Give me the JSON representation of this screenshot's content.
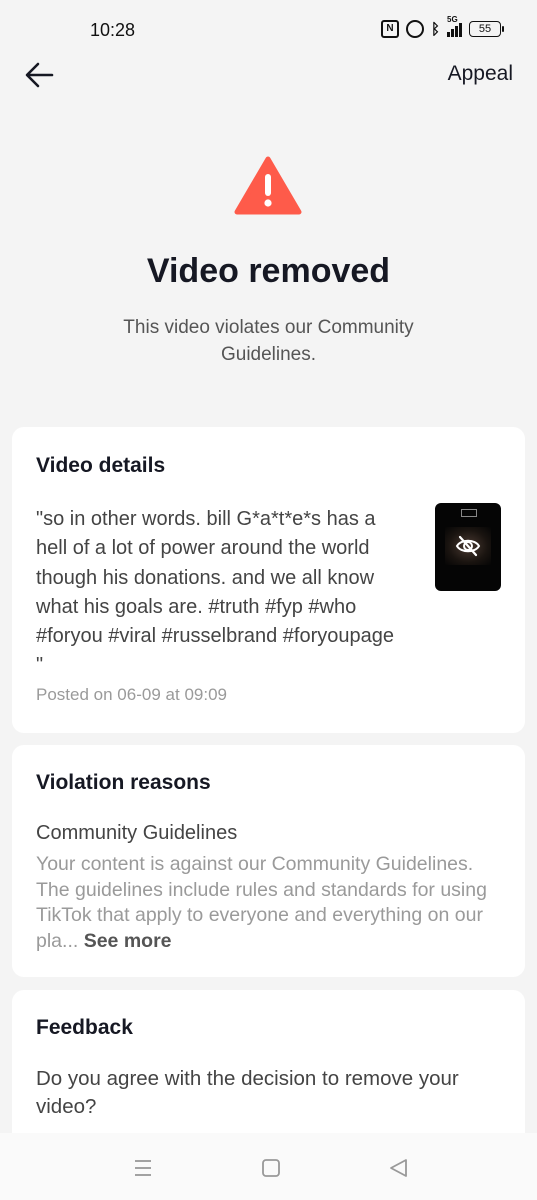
{
  "status_bar": {
    "time": "10:28",
    "network": "5G",
    "battery": "55",
    "icons": [
      "nfc-icon",
      "alarm-icon",
      "bluetooth-icon",
      "signal-icon",
      "battery-icon"
    ]
  },
  "header": {
    "back_icon": "back-arrow-icon",
    "appeal_label": "Appeal"
  },
  "hero": {
    "icon": "warning-icon",
    "icon_color": "#fe5b4a",
    "title": "Video removed",
    "subtitle": "This video violates our Community Guidelines."
  },
  "video_details": {
    "title": "Video details",
    "caption": "\"so in other words. bill G*a*t*e*s has a hell of a lot of power around the world though his donations. and we all know what his goals are. #truth #fyp #who #foryou #viral #russelbrand #foryoupage \"",
    "posted_prefix": "Posted on",
    "posted_date": "06-09",
    "posted_at": "at",
    "posted_time": "09:09",
    "thumbnail_icon": "hidden-eye-icon"
  },
  "violation": {
    "title": "Violation reasons",
    "reason_name": "Community Guidelines",
    "reason_text": "Your content is against our Community Guidelines. The guidelines include rules and standards for using TikTok that apply to everyone and everything on our pla...",
    "see_more": "See more"
  },
  "feedback": {
    "title": "Feedback",
    "question": "Do you agree with the decision to remove your video?"
  },
  "nav_bar": {
    "icons": [
      "menu-icon",
      "home-square-icon",
      "back-triangle-icon"
    ]
  }
}
